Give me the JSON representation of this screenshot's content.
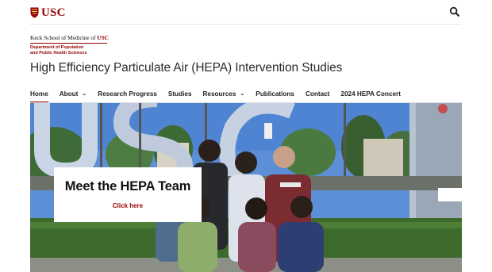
{
  "header": {
    "logo_text": "USC",
    "search_icon": "search-icon"
  },
  "keck": {
    "school_prefix": "Keck School of Medicine of ",
    "school_usc": "USC",
    "department": "Department of Population\nand Public Health Sciences"
  },
  "site": {
    "title": "High Efficiency Particulate Air (HEPA) Intervention Studies"
  },
  "nav": {
    "items": [
      {
        "label": "Home",
        "active": true
      },
      {
        "label": "About",
        "dropdown": true
      },
      {
        "label": "Research Progress"
      },
      {
        "label": "Studies"
      },
      {
        "label": "Resources",
        "dropdown": true
      },
      {
        "label": "Publications"
      },
      {
        "label": "Contact"
      },
      {
        "label": "2024 HEPA Concert"
      }
    ],
    "dropdown_glyph": "⌄"
  },
  "hero": {
    "callout_title": "Meet the HEPA Team",
    "callout_link": "Click here",
    "sign_text": "USC"
  },
  "colors": {
    "brand": "#990000",
    "text": "#222222",
    "rule": "#dddddd"
  }
}
